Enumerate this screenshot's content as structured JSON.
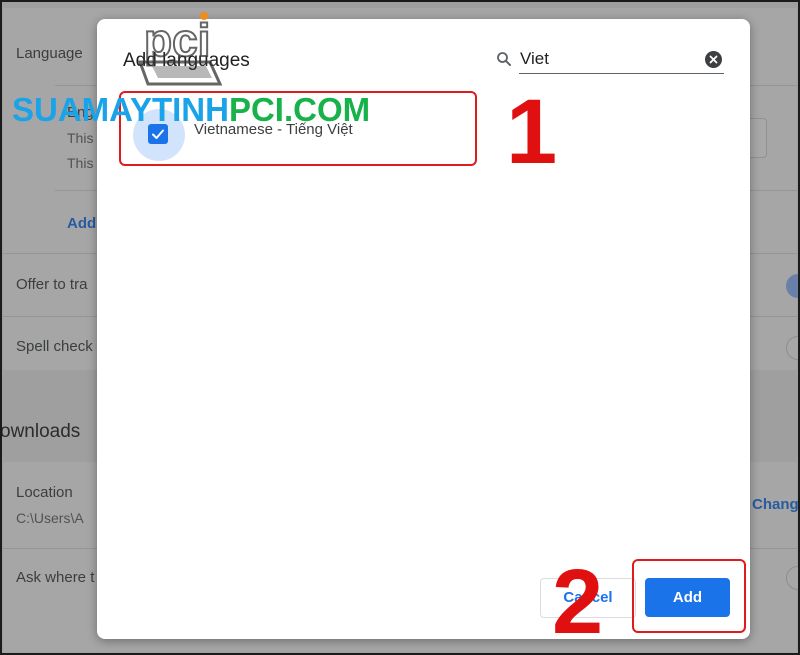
{
  "settings": {
    "language_label": "Language",
    "lang_primary_name": "Eng",
    "lang_sub_line_1": "This",
    "lang_sub_line_2": "This",
    "add_languages_link": "Add",
    "offer_translate_label": "Offer to tra",
    "spell_check_label": "Spell check",
    "downloads_title": "ownloads",
    "location_label": "Location",
    "location_path": "C:\\Users\\A",
    "change_button": "Chang",
    "ask_where_label": "Ask where t"
  },
  "dialog": {
    "title": "Add languages",
    "search": {
      "value": "Viet",
      "placeholder": ""
    },
    "results": [
      {
        "label": "Vietnamese - Tiếng Việt",
        "checked": true
      }
    ],
    "cancel_label": "Cancel",
    "add_label": "Add"
  },
  "annotations": {
    "step_1": "1",
    "step_2": "2",
    "highlight_color": "#e01b1b"
  },
  "watermark": {
    "logo_text": "pci",
    "text_part_1": "SUAMAYTINH",
    "text_part_2": "PCI.COM"
  },
  "colors": {
    "accent": "#1a73e8",
    "annotation_red": "#e01010"
  }
}
